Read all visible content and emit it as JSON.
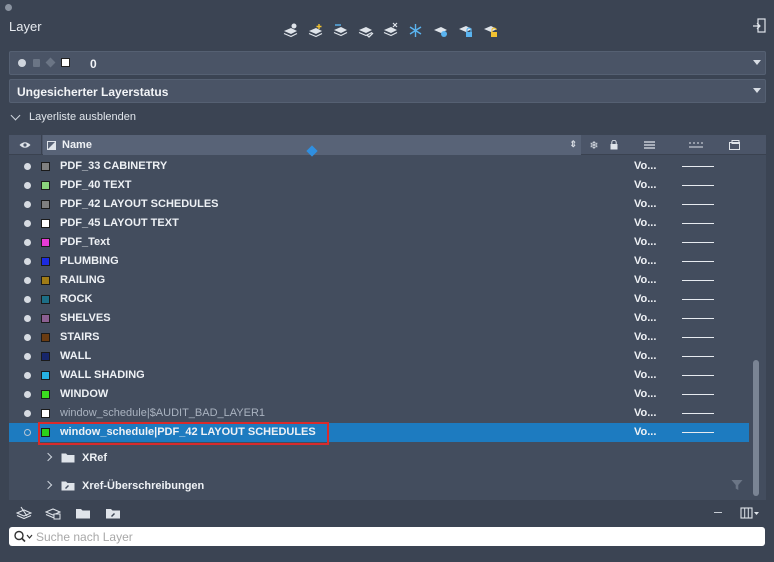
{
  "panel": {
    "title": "Layer"
  },
  "toolbar": {
    "icons": [
      "new-layer-icon",
      "new-layer-frozen-icon",
      "merge-layers-icon",
      "set-current-icon",
      "delete-layer-icon",
      "freeze-icon",
      "isolate-icon",
      "lock-icon",
      "unlock-icon"
    ]
  },
  "current_layer": {
    "name": "0",
    "swatch_color": "#ffffff"
  },
  "layer_state": {
    "value": "Ungesicherter Layerstatus"
  },
  "collapse_label": "Layerliste ausblenden",
  "columns": {
    "name": "Name"
  },
  "layers": [
    {
      "name": "PDF_33 CABINETRY",
      "color": "#7f7f7f",
      "linetype": "Vo...",
      "visible": true,
      "dim": false
    },
    {
      "name": "PDF_40 TEXT",
      "color": "#8ad37c",
      "linetype": "Vo...",
      "visible": true,
      "dim": false
    },
    {
      "name": "PDF_42 LAYOUT SCHEDULES",
      "color": "#7f7f7f",
      "linetype": "Vo...",
      "visible": true,
      "dim": false
    },
    {
      "name": "PDF_45 LAYOUT TEXT",
      "color": "#ffffff",
      "linetype": "Vo...",
      "visible": true,
      "dim": false
    },
    {
      "name": "PDF_Text",
      "color": "#e83bd5",
      "linetype": "Vo...",
      "visible": true,
      "dim": false
    },
    {
      "name": "PLUMBING",
      "color": "#1c2be0",
      "linetype": "Vo...",
      "visible": true,
      "dim": false
    },
    {
      "name": "RAILING",
      "color": "#a07b16",
      "linetype": "Vo...",
      "visible": true,
      "dim": false
    },
    {
      "name": "ROCK",
      "color": "#1d6e86",
      "linetype": "Vo...",
      "visible": true,
      "dim": false
    },
    {
      "name": "SHELVES",
      "color": "#8b5f91",
      "linetype": "Vo...",
      "visible": true,
      "dim": false
    },
    {
      "name": "STAIRS",
      "color": "#6b3c12",
      "linetype": "Vo...",
      "visible": true,
      "dim": false
    },
    {
      "name": "WALL",
      "color": "#17266b",
      "linetype": "Vo...",
      "visible": true,
      "dim": false
    },
    {
      "name": "WALL SHADING",
      "color": "#27b1e2",
      "linetype": "Vo...",
      "visible": true,
      "dim": false
    },
    {
      "name": "WINDOW",
      "color": "#3bdc1f",
      "linetype": "Vo...",
      "visible": true,
      "dim": false
    },
    {
      "name": "window_schedule|$AUDIT_BAD_LAYER1",
      "color": "#ffffff",
      "linetype": "Vo...",
      "visible": true,
      "dim": true
    },
    {
      "name": "window_schedule|PDF_42 LAYOUT SCHEDULES",
      "color": "#2bd11a",
      "linetype": "Vo...",
      "visible": false,
      "dim": false
    }
  ],
  "groups": [
    {
      "label": "XRef"
    },
    {
      "label": "Xref-Überschreibungen"
    }
  ],
  "search": {
    "placeholder": "Suche nach Layer"
  }
}
